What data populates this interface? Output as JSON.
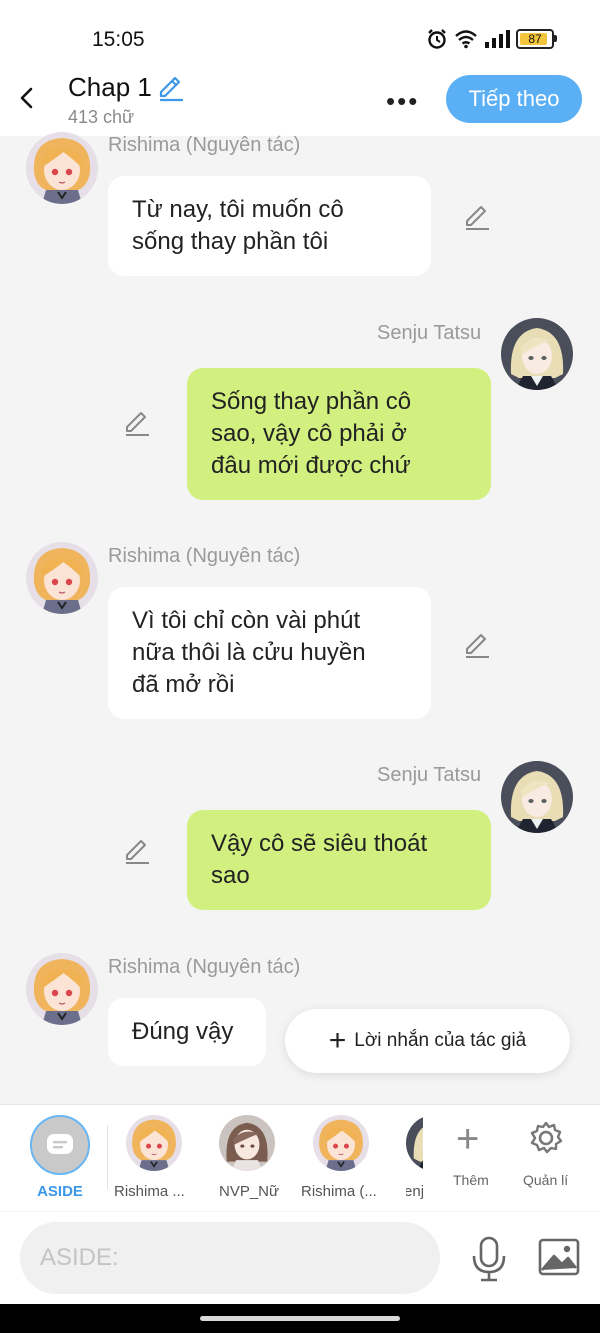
{
  "status": {
    "time": "15:05",
    "battery": "87"
  },
  "header": {
    "title": "Chap 1",
    "word_count": "413 chữ",
    "next_label": "Tiếp theo"
  },
  "messages": [
    {
      "side": "left",
      "name": "Rishima (Nguyên tác)",
      "text_lines": [
        "Từ nay, tôi muốn cô",
        "sống thay phần tôi"
      ]
    },
    {
      "side": "right",
      "name": "Senju Tatsu",
      "text_lines": [
        "Sống thay phần cô",
        "sao, vậy cô phải ở",
        "đâu mới được chứ"
      ]
    },
    {
      "side": "left",
      "name": "Rishima (Nguyên tác)",
      "text_lines": [
        "Vì tôi chỉ còn vài phút",
        "nữa thôi là cửu huyền",
        "đã mở rồi"
      ]
    },
    {
      "side": "right",
      "name": "Senju Tatsu",
      "text_lines": [
        "Vậy cô sẽ siêu thoát",
        "sao"
      ]
    },
    {
      "side": "left",
      "name": "Rishima (Nguyên tác)",
      "text_lines": [
        "Đúng vậy"
      ]
    }
  ],
  "author_note_label": "Lời nhắn của tác giả",
  "characters": {
    "aside_label": "ASIDE",
    "items": [
      "Rishima ...",
      "NVP_Nữ",
      "Rishima (...",
      "Senj"
    ],
    "add_label": "Thêm",
    "manage_label": "Quản lí"
  },
  "input": {
    "placeholder": "ASIDE:"
  },
  "colors": {
    "accent": "#5aaff5",
    "right_bubble": "#d1f07f",
    "left_bubble": "#ffffff"
  },
  "icons": [
    "back-arrow-icon",
    "pencil-icon",
    "more-icon",
    "plus-icon",
    "gear-icon",
    "microphone-icon",
    "image-icon"
  ]
}
